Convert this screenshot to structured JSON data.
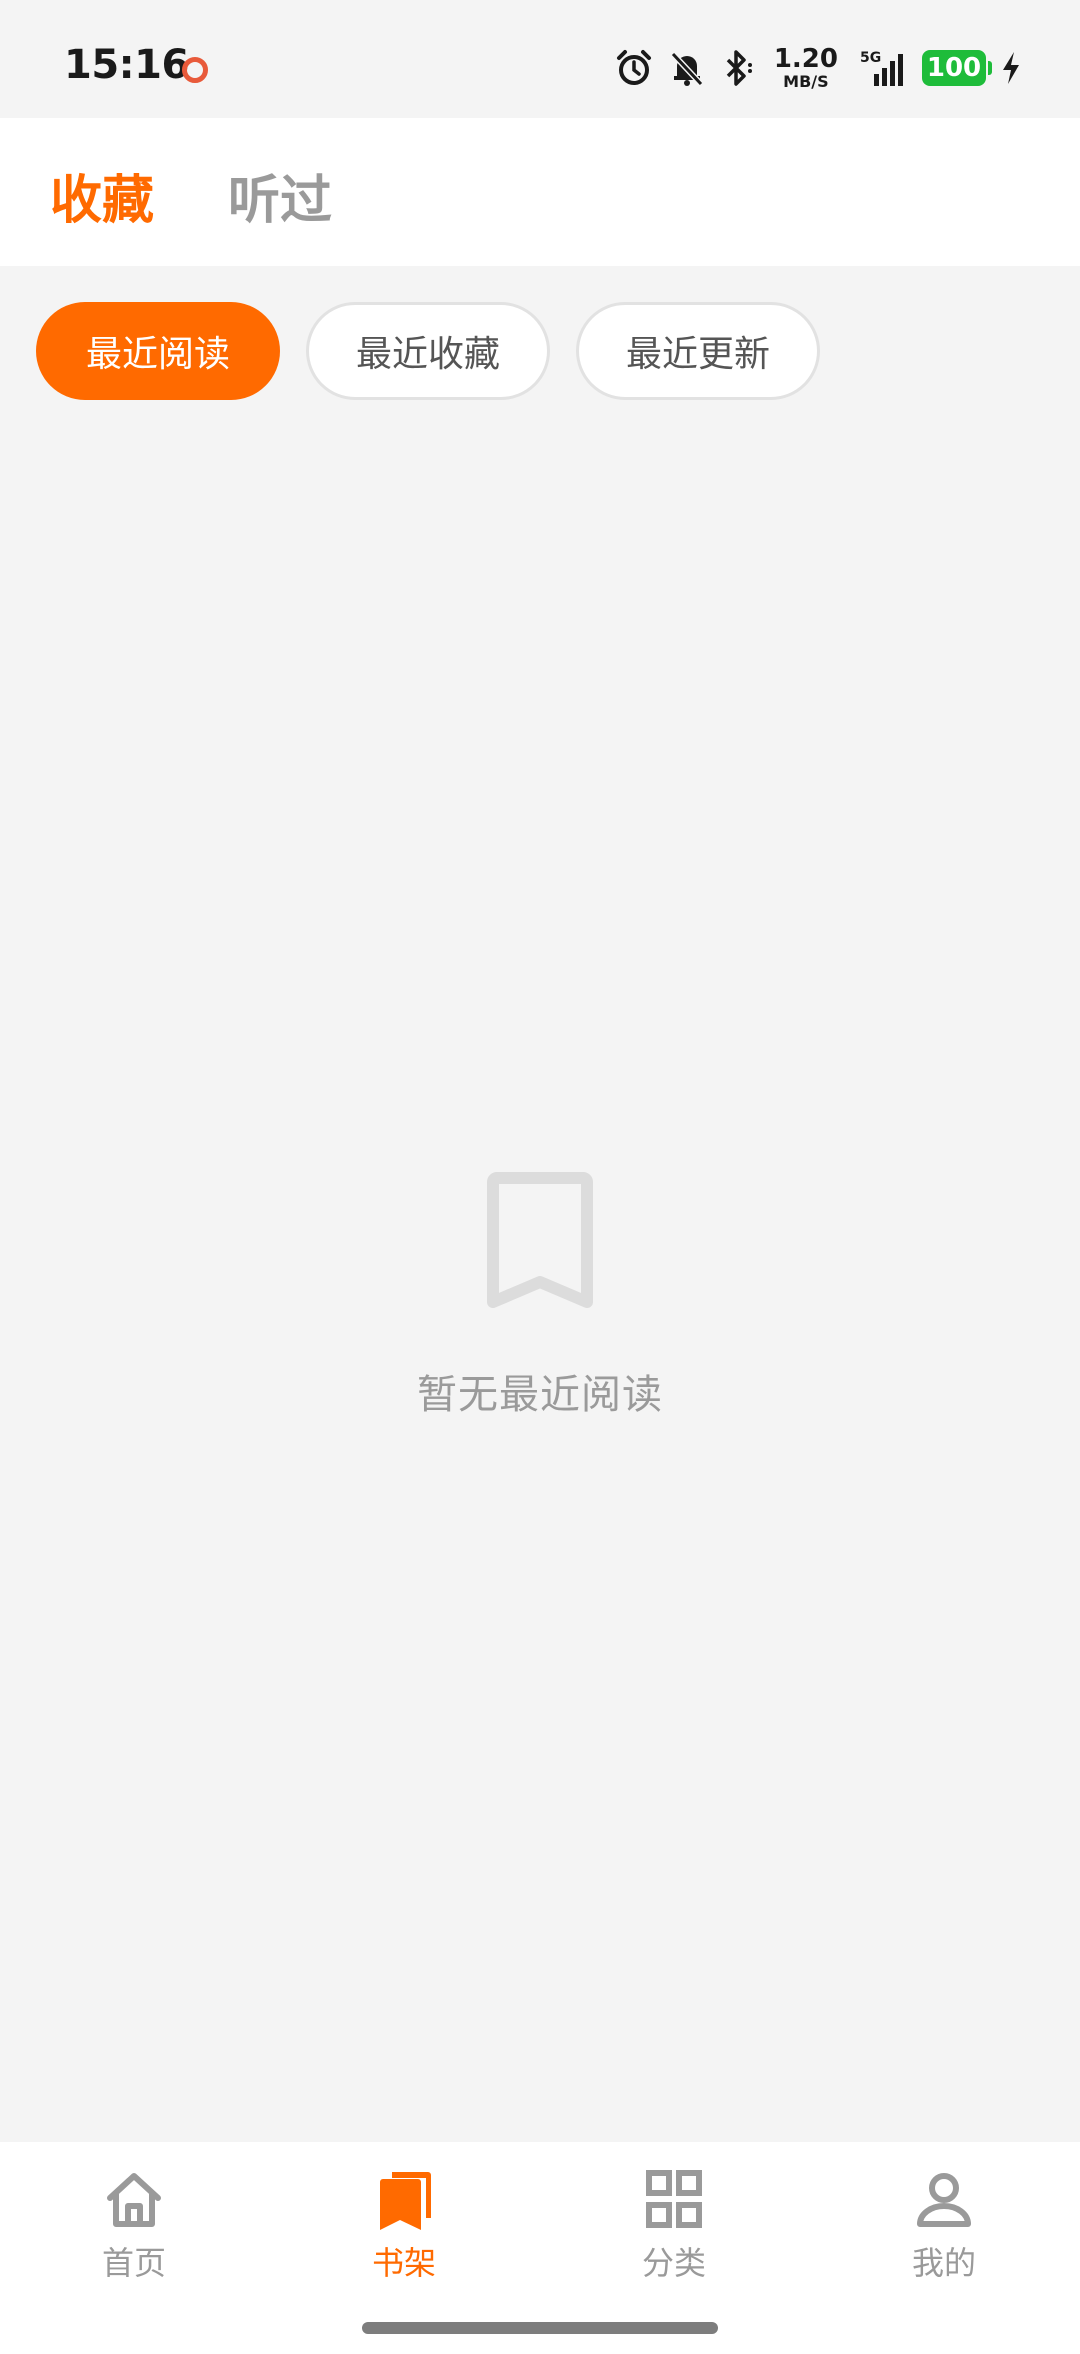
{
  "status_bar": {
    "time": "15:16",
    "network_speed_value": "1.20",
    "network_speed_unit": "MB/S",
    "signal_label": "5G",
    "battery_level": "100"
  },
  "header": {
    "tabs": [
      {
        "label": "收藏",
        "active": true
      },
      {
        "label": "听过",
        "active": false
      }
    ]
  },
  "filters": {
    "chips": [
      {
        "label": "最近阅读",
        "active": true
      },
      {
        "label": "最近收藏",
        "active": false
      },
      {
        "label": "最近更新",
        "active": false
      }
    ]
  },
  "empty_state": {
    "icon": "bookmark-icon",
    "message": "暂无最近阅读"
  },
  "bottom_nav": {
    "items": [
      {
        "label": "首页",
        "icon": "home-icon",
        "active": false
      },
      {
        "label": "书架",
        "icon": "bookshelf-icon",
        "active": true
      },
      {
        "label": "分类",
        "icon": "grid-icon",
        "active": false
      },
      {
        "label": "我的",
        "icon": "user-icon",
        "active": false
      }
    ]
  },
  "colors": {
    "accent": "#ff6a00",
    "muted_text": "#9a9a9a",
    "background": "#f4f4f4",
    "battery": "#1ebc3a"
  }
}
